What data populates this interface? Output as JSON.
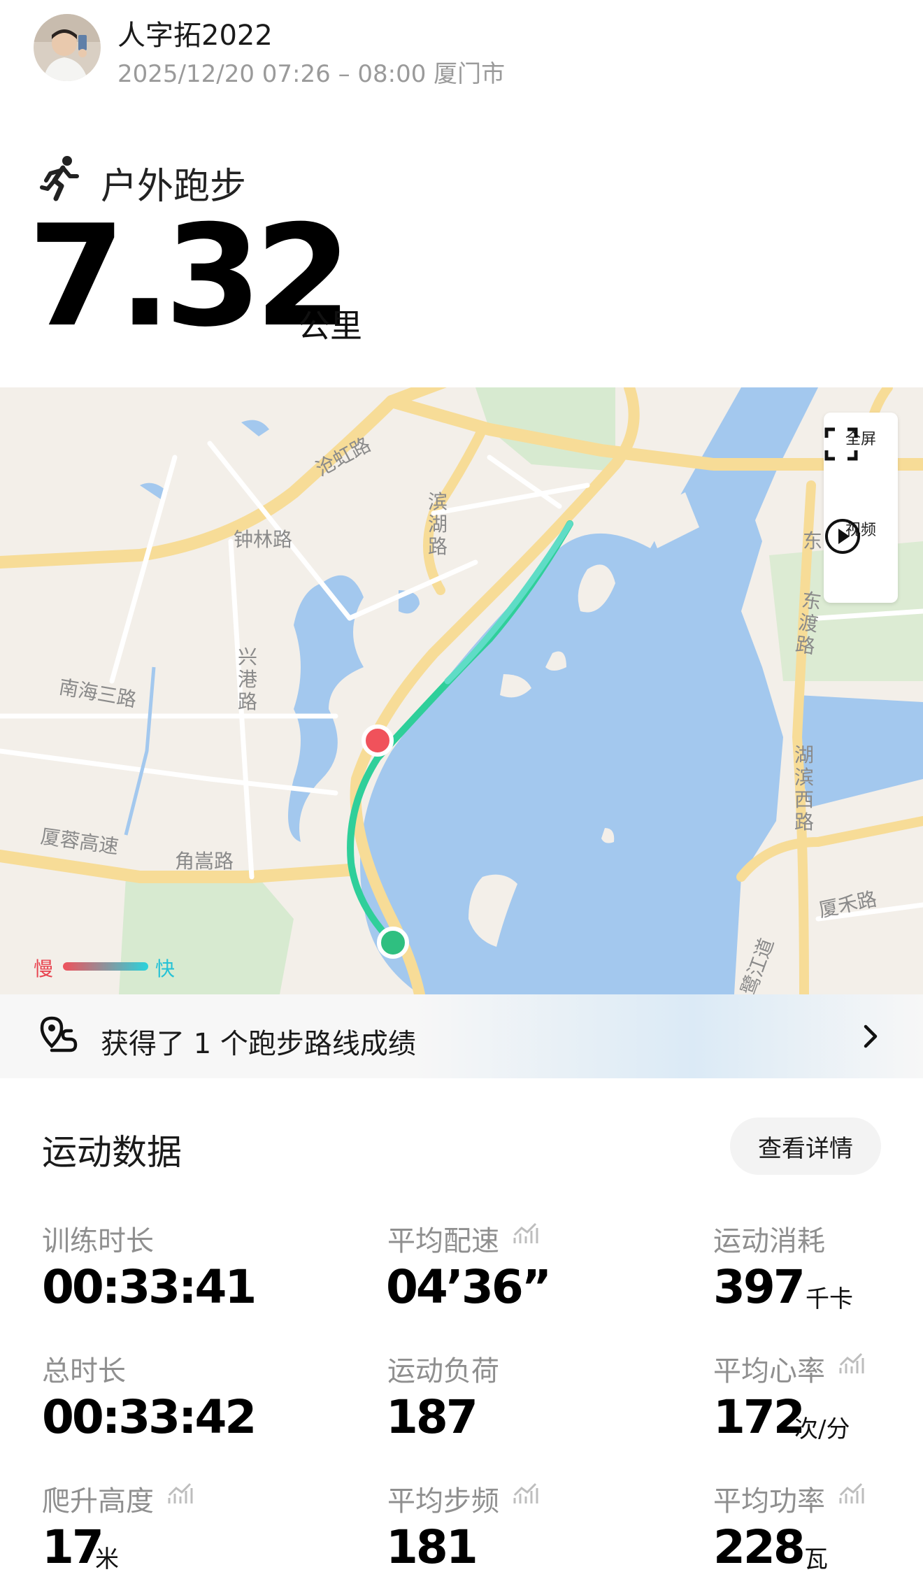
{
  "header": {
    "username": "人字拓2022",
    "meta": "2025/12/20 07:26 – 08:00 厦门市"
  },
  "workout": {
    "sport_icon": "running-person-icon",
    "sport_type": "户外跑步",
    "distance": "7.32",
    "distance_unit": "公里"
  },
  "map": {
    "labels": {
      "canghong": "沧虹路",
      "zhonglin": "钟林路",
      "binhu": "滨湖路",
      "nanhai": "南海三路",
      "xinggang": "兴港路",
      "xiarong": "厦蓉高速",
      "jiaosong": "角嵩路",
      "dongdu_east": "东",
      "dongdu": "东渡路",
      "hubinxi": "湖滨西路",
      "xiahe": "厦禾路",
      "heshan": "鹭江道"
    },
    "controls": {
      "fullscreen": "全屏",
      "video": "视频"
    },
    "legend": {
      "slow": "慢",
      "fast": "快",
      "slow_color": "#f0525b",
      "fast_color": "#2ad3dc"
    },
    "colors": {
      "water": "#a3c8ee",
      "land": "#f3efe9",
      "park": "#d7ead0",
      "road": "#f7dc97",
      "route": "#2fcf9a",
      "start": "#2fbf80",
      "end": "#f0525b"
    }
  },
  "achievement": {
    "icon": "route-pin-icon",
    "text": "获得了 1 个跑步路线成绩"
  },
  "stats_section": {
    "title": "运动数据",
    "detail_button": "查看详情",
    "items": [
      {
        "label": "训练时长",
        "value": "00:33:41",
        "unit": ""
      },
      {
        "label": "平均配速",
        "value": "04’36”",
        "unit": ""
      },
      {
        "label": "运动消耗",
        "value": "397",
        "unit": "千卡"
      },
      {
        "label": "总时长",
        "value": "00:33:42",
        "unit": ""
      },
      {
        "label": "运动负荷",
        "value": "187",
        "unit": ""
      },
      {
        "label": "平均心率",
        "value": "172",
        "unit": "次/分"
      },
      {
        "label": "爬升高度",
        "value": "17",
        "unit": "米"
      },
      {
        "label": "平均步频",
        "value": "181",
        "unit": ""
      },
      {
        "label": "平均功率",
        "value": "228",
        "unit": "瓦"
      }
    ]
  }
}
